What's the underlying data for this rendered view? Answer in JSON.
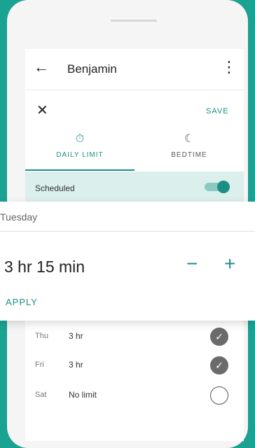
{
  "header": {
    "title": "Benjamin",
    "back_icon": "←",
    "more_icon": "⋮"
  },
  "actions": {
    "close_icon": "✕",
    "save_label": "SAVE"
  },
  "tabs": [
    {
      "label": "DAILY LIMIT",
      "icon": "timer-icon",
      "glyph": "⏱",
      "active": true
    },
    {
      "label": "BEDTIME",
      "icon": "moon-icon",
      "glyph": "☾",
      "active": false
    }
  ],
  "scheduled": {
    "label": "Scheduled",
    "enabled": true
  },
  "days": [
    {
      "day": "Thu",
      "value": "3 hr",
      "checked": true
    },
    {
      "day": "Fri",
      "value": "3 hr",
      "checked": true
    },
    {
      "day": "Sat",
      "value": "No limit",
      "checked": false
    }
  ],
  "editor": {
    "day": "Tuesday",
    "time": "3 hr 15 min",
    "minus": "−",
    "plus": "+",
    "apply_label": "APPLY"
  },
  "colors": {
    "accent": "#1b8f84",
    "background": "#1aa293",
    "highlight": "#dbefec"
  }
}
